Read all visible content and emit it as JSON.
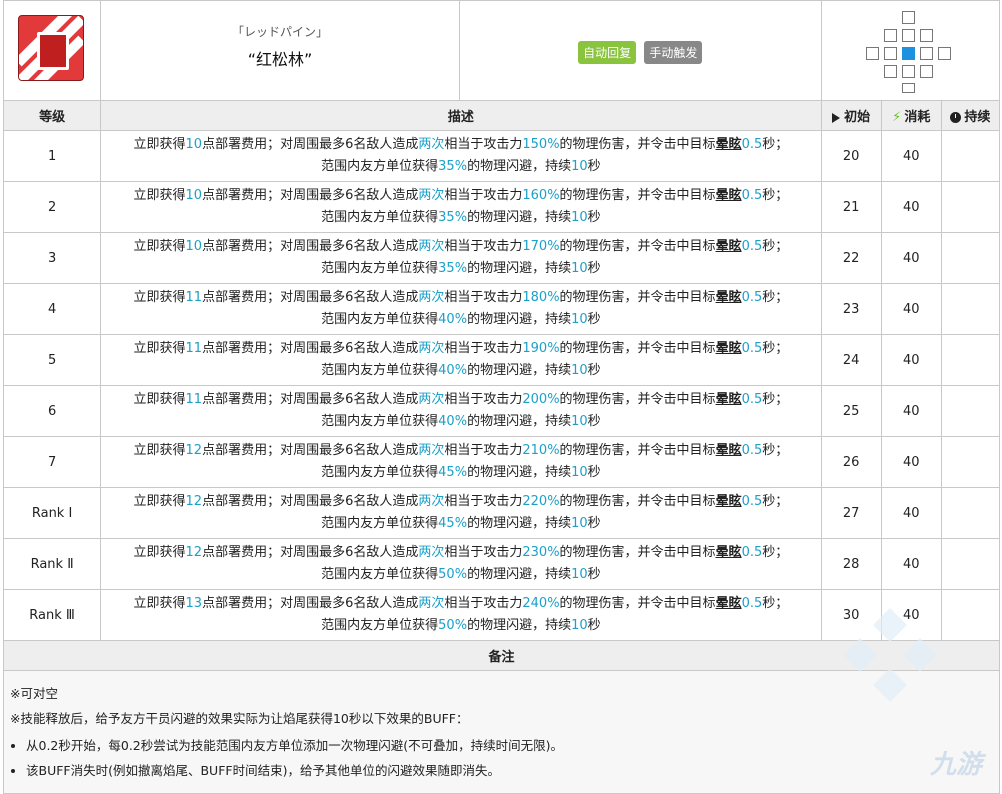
{
  "skill": {
    "name_jp": "「レッドパイン」",
    "name_cn": "“红松林”",
    "tags": [
      "自动回复",
      "手动触发"
    ],
    "icon": "skill-red-pine-icon"
  },
  "headers": {
    "level": "等级",
    "description": "描述",
    "initial": "初始",
    "cost": "消耗",
    "duration": "持续"
  },
  "rows": [
    {
      "level": "1",
      "dp": "10",
      "hits": "两次",
      "atk": "150%",
      "stun": "晕眩",
      "stun_sec": "0.5",
      "dodge": "35%",
      "dodge_sec": "10",
      "initial": "20",
      "cost": "40",
      "duration": ""
    },
    {
      "level": "2",
      "dp": "10",
      "hits": "两次",
      "atk": "160%",
      "stun": "晕眩",
      "stun_sec": "0.5",
      "dodge": "35%",
      "dodge_sec": "10",
      "initial": "21",
      "cost": "40",
      "duration": ""
    },
    {
      "level": "3",
      "dp": "10",
      "hits": "两次",
      "atk": "170%",
      "stun": "晕眩",
      "stun_sec": "0.5",
      "dodge": "35%",
      "dodge_sec": "10",
      "initial": "22",
      "cost": "40",
      "duration": ""
    },
    {
      "level": "4",
      "dp": "11",
      "hits": "两次",
      "atk": "180%",
      "stun": "晕眩",
      "stun_sec": "0.5",
      "dodge": "40%",
      "dodge_sec": "10",
      "initial": "23",
      "cost": "40",
      "duration": ""
    },
    {
      "level": "5",
      "dp": "11",
      "hits": "两次",
      "atk": "190%",
      "stun": "晕眩",
      "stun_sec": "0.5",
      "dodge": "40%",
      "dodge_sec": "10",
      "initial": "24",
      "cost": "40",
      "duration": ""
    },
    {
      "level": "6",
      "dp": "11",
      "hits": "两次",
      "atk": "200%",
      "stun": "晕眩",
      "stun_sec": "0.5",
      "dodge": "40%",
      "dodge_sec": "10",
      "initial": "25",
      "cost": "40",
      "duration": ""
    },
    {
      "level": "7",
      "dp": "12",
      "hits": "两次",
      "atk": "210%",
      "stun": "晕眩",
      "stun_sec": "0.5",
      "dodge": "45%",
      "dodge_sec": "10",
      "initial": "26",
      "cost": "40",
      "duration": ""
    },
    {
      "level": "Rank Ⅰ",
      "dp": "12",
      "hits": "两次",
      "atk": "220%",
      "stun": "晕眩",
      "stun_sec": "0.5",
      "dodge": "45%",
      "dodge_sec": "10",
      "initial": "27",
      "cost": "40",
      "duration": ""
    },
    {
      "level": "Rank Ⅱ",
      "dp": "12",
      "hits": "两次",
      "atk": "230%",
      "stun": "晕眩",
      "stun_sec": "0.5",
      "dodge": "50%",
      "dodge_sec": "10",
      "initial": "28",
      "cost": "40",
      "duration": ""
    },
    {
      "level": "Rank Ⅲ",
      "dp": "13",
      "hits": "两次",
      "atk": "240%",
      "stun": "晕眩",
      "stun_sec": "0.5",
      "dodge": "50%",
      "dodge_sec": "10",
      "initial": "30",
      "cost": "40",
      "duration": ""
    }
  ],
  "desc_text": {
    "p1": "立即获得",
    "p2": "点部署费用；对周围最多6名敌人造成",
    "p3": "相当于攻击力",
    "p4": "的物理伤害，并令击中目标",
    "p5": "秒；",
    "p6": "范围内友方单位获得",
    "p7": "的物理闪避，持续",
    "p8": "秒"
  },
  "notes": {
    "title": "备注",
    "line1": "※可对空",
    "line2": "※技能释放后，给予友方干员闪避的效果实际为让焰尾获得10秒以下效果的BUFF：",
    "bullets": [
      "从0.2秒开始，每0.2秒尝试为技能范围内友方单位添加一次物理闪避(不可叠加，持续时间无限)。",
      "该BUFF消失时(例如撤离焰尾、BUFF时间结束)，给予其他单位的闪避效果随即消失。"
    ]
  },
  "watermark": "九游",
  "colors": {
    "highlight": "#1ca0c8",
    "tag_auto": "#8ac43f",
    "tag_manual": "#888888",
    "range_self": "#1e90e0"
  }
}
